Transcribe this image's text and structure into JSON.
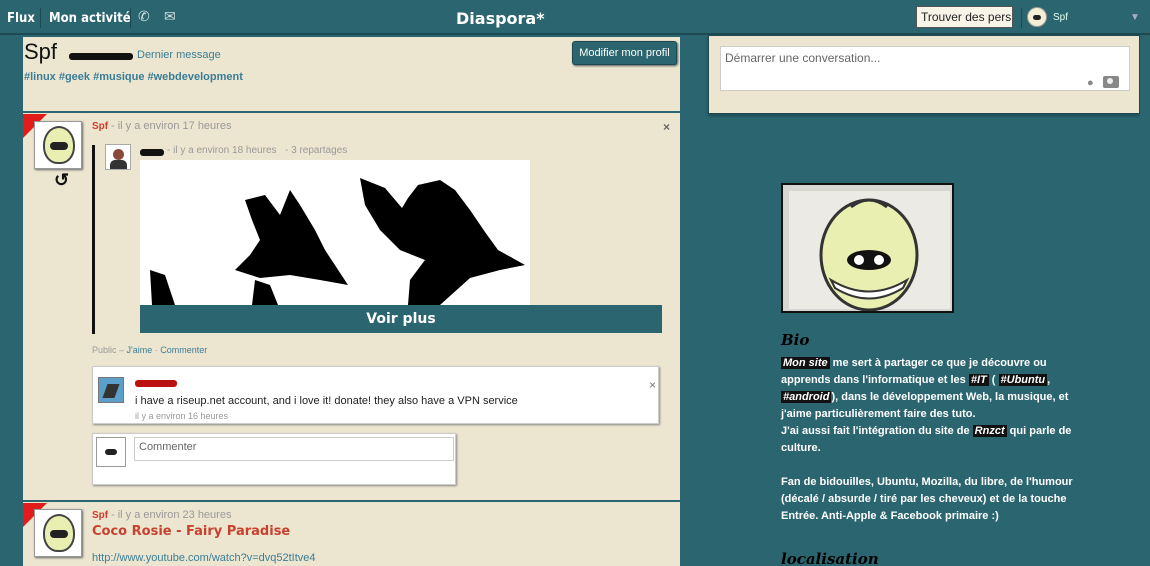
{
  "topbar": {
    "nav_flux": "Flux",
    "nav_activity": "Mon activité",
    "brand": "Diaspora*",
    "search_placeholder": "Trouver des pers",
    "user_name": "Spf"
  },
  "profile": {
    "name": "Spf",
    "last_message": "Dernier message",
    "tags": "#linux #geek #musique #webdevelopment",
    "edit_button": "Modifier mon profil"
  },
  "post1": {
    "author": "Spf",
    "time": "- il y a environ 17 heures",
    "reshare_time": "- il y a environ 18 heures",
    "reshare_count": "- 3 repartages",
    "voir_plus": "Voir plus",
    "visibility": "Public –",
    "like": "J'aime",
    "comment": "Commenter",
    "comment_text": "i have a riseup.net account, and i love it! donate! they also have a VPN service",
    "comment_time": "il y a environ 16 heures",
    "new_comment_placeholder": "Commenter"
  },
  "post2": {
    "author": "Spf",
    "time": "- il y a environ 23 heures",
    "title": "Coco Rosie - Fairy Paradise",
    "link": "http://www.youtube.com/watch?v=dvq52tItve4"
  },
  "sidebar": {
    "convo_placeholder": "Démarrer une conversation...",
    "bio_title": "Bio",
    "bio_tag_site": "Mon site",
    "bio_p1a": " me sert à partager ce que je découvre ou apprends dans l'informatique et les ",
    "bio_tag_it": "#IT",
    "bio_p1b": " ( ",
    "bio_tag_ubuntu": "#Ubuntu",
    "bio_p1c": ", ",
    "bio_tag_android": "#android",
    "bio_p1d": "), dans le développement Web, la musique, et j'aime particulièrement faire des tuto.",
    "bio_p2a": "J'ai aussi fait l'intégration du site de ",
    "bio_tag_rnzct": "Rnzct",
    "bio_p2b": " qui parle de culture.",
    "bio_p3": "Fan de bidouilles, Ubuntu, Mozilla, du libre, de l'humour (décalé / absurde / tiré par les cheveux) et de la touche Entrée. Anti-Apple & Facebook primaire :)",
    "loc_title": "localisation"
  },
  "colors": {
    "teal": "#2b6670",
    "cream": "#ece6d0",
    "link": "#3a7d96",
    "author_red": "#d23a2a"
  }
}
